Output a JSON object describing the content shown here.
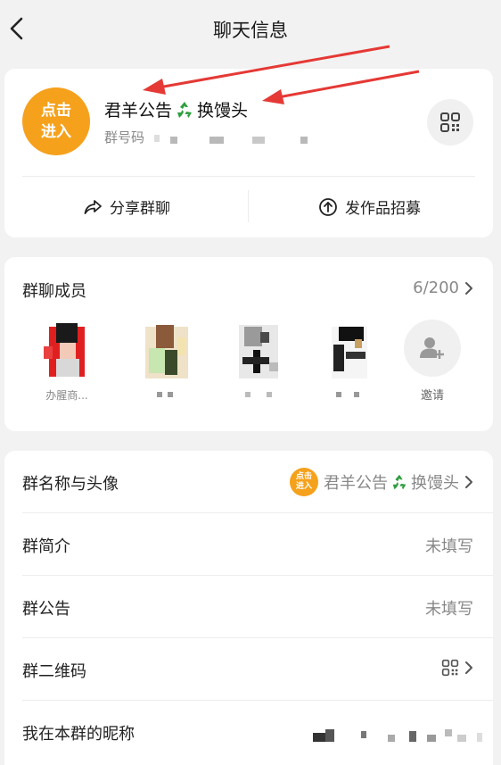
{
  "header": {
    "title": "聊天信息"
  },
  "group": {
    "avatar_text": "点击进入",
    "name": "君羊公告",
    "name_suffix": "换馒头",
    "id_label": "群号码",
    "share_label": "分享群聊",
    "recruit_label": "发作品招募"
  },
  "members": {
    "title": "群聊成员",
    "count": "6/200",
    "list": [
      {
        "name": "办腥商..."
      },
      {
        "name": ""
      },
      {
        "name": ""
      },
      {
        "name": ""
      }
    ],
    "invite_label": "邀请"
  },
  "settings": {
    "name_avatar": {
      "label": "群名称与头像",
      "value": "君羊公告",
      "value_suffix": "换馒头",
      "avatar_text": "点击进入"
    },
    "intro": {
      "label": "群简介",
      "value": "未填写"
    },
    "notice": {
      "label": "群公告",
      "value": "未填写"
    },
    "qrcode": {
      "label": "群二维码"
    },
    "nickname": {
      "label": "我在本群的昵称"
    }
  },
  "colors": {
    "accent_orange": "#f5a11c",
    "annotation_red": "#e53935"
  }
}
